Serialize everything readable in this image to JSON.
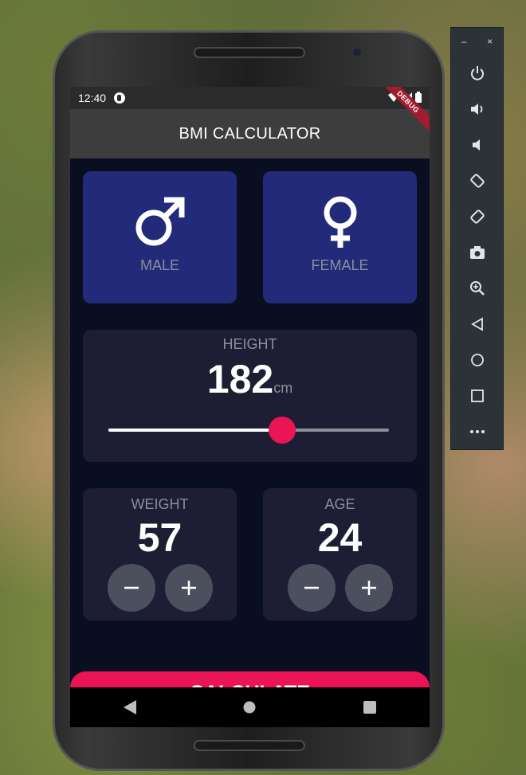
{
  "status": {
    "time": "12:40",
    "debug_label": "DEBUG"
  },
  "appbar": {
    "title": "BMI CALCULATOR"
  },
  "gender": {
    "male": {
      "label": "MALE",
      "icon": "male-symbol-icon",
      "selected": true
    },
    "female": {
      "label": "FEMALE",
      "icon": "female-symbol-icon",
      "selected": true
    }
  },
  "height": {
    "label": "HEIGHT",
    "value": "182",
    "unit": "cm",
    "slider_fraction": 0.62
  },
  "weight": {
    "label": "WEIGHT",
    "value": "57"
  },
  "age": {
    "label": "AGE",
    "value": "24"
  },
  "calculate": {
    "label": "CALCULATE"
  },
  "colors": {
    "accent": "#eb1555",
    "background": "#0a0e21",
    "active_card": "#232a7a",
    "inactive_card": "#1d1e33"
  },
  "navbar": {
    "icons": [
      "back-icon",
      "home-icon",
      "recents-icon"
    ]
  },
  "emulator_panel": {
    "window_controls": [
      "minimize-icon",
      "close-icon"
    ],
    "buttons": [
      "power-icon",
      "volume-up-icon",
      "volume-down-icon",
      "rotate-left-icon",
      "rotate-right-icon",
      "camera-icon",
      "zoom-icon",
      "back-icon",
      "home-icon",
      "overview-icon",
      "more-icon"
    ]
  }
}
